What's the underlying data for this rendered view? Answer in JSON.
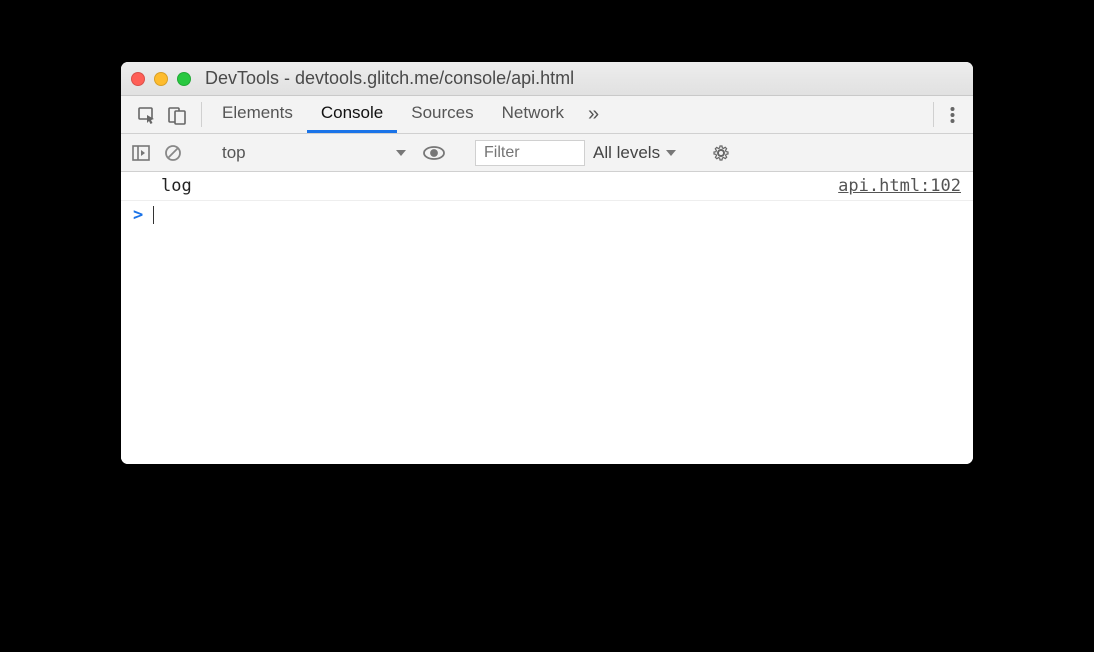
{
  "window": {
    "title": "DevTools - devtools.glitch.me/console/api.html"
  },
  "tabs": {
    "elements": "Elements",
    "console": "Console",
    "sources": "Sources",
    "network": "Network",
    "overflow": "»"
  },
  "toolbar": {
    "context": "top",
    "filter_placeholder": "Filter",
    "levels": "All levels"
  },
  "console": {
    "entries": [
      {
        "text": "log",
        "source": "api.html:102"
      }
    ],
    "prompt": ">"
  }
}
